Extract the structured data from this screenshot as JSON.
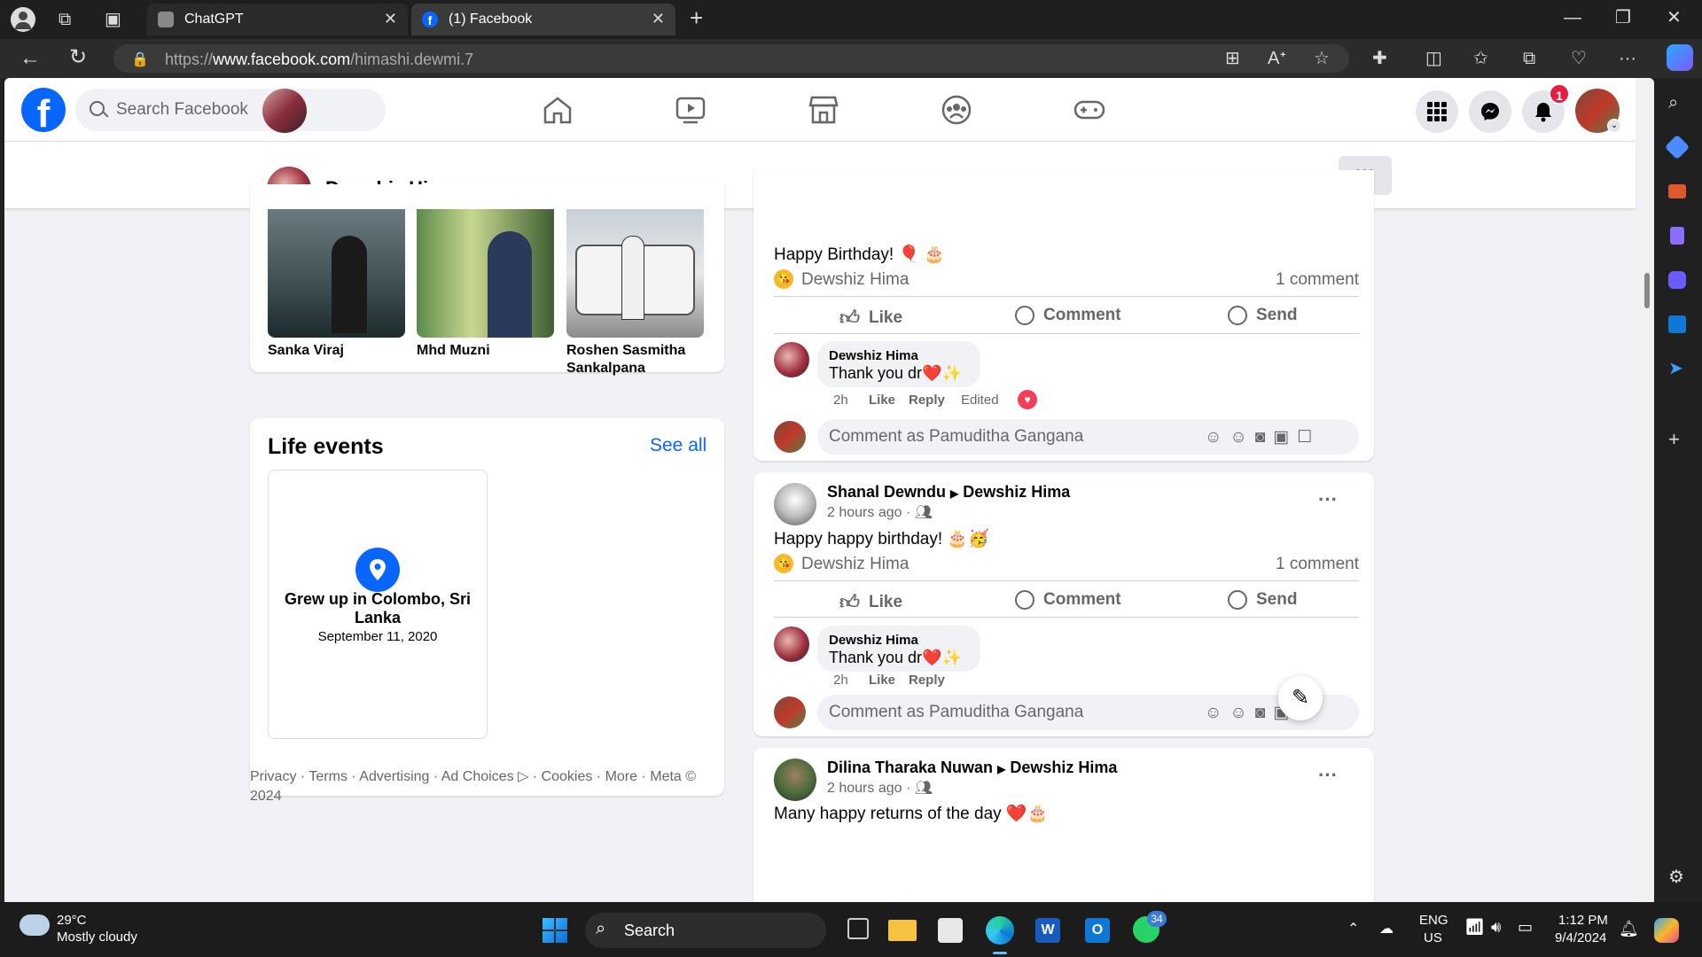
{
  "browser": {
    "tabs": [
      {
        "title": "ChatGPT",
        "active": false
      },
      {
        "title": "(1) Facebook",
        "active": true
      }
    ],
    "url_prefix": "https://",
    "url_domain": "www.facebook.com",
    "url_path": "/himashi.dewmi.7"
  },
  "fb": {
    "search_placeholder": "Search Facebook",
    "notification_count": "1",
    "profile_name": "Dewshiz Hima",
    "more_label": "···"
  },
  "friends": [
    {
      "name": "Sanka Viraj"
    },
    {
      "name": "Mhd Muzni"
    },
    {
      "name": "Roshen Sasmitha Sankalpana"
    }
  ],
  "life_events": {
    "title": "Life events",
    "see_all": "See all",
    "event_title": "Grew up in Colombo, Sri Lanka",
    "event_date": "September 11, 2020"
  },
  "footer": {
    "text": "Privacy · Terms · Advertising · Ad Choices ▷ · Cookies · More · Meta © 2024"
  },
  "post1": {
    "text": "Happy Birthday! 🎈 🎂",
    "reactor": "Dewshiz Hima",
    "comments": "1 comment",
    "reply_author": "Dewshiz Hima",
    "reply_text": "Thank you dr❤️✨",
    "reply_time": "2h",
    "reply_like": "Like",
    "reply_reply": "Reply",
    "reply_edited": "Edited",
    "comment_placeholder": "Comment as Pamuditha Gangana"
  },
  "post2": {
    "author": "Shanal Dewndu",
    "target": "Dewshiz Hima",
    "time": "2 hours ago ·",
    "text": "Happy happy birthday! 🎂🥳",
    "reactor": "Dewshiz Hima",
    "comments": "1 comment",
    "reply_author": "Dewshiz Hima",
    "reply_text": "Thank you dr❤️✨",
    "reply_time": "2h",
    "reply_like": "Like",
    "reply_reply": "Reply",
    "comment_placeholder": "Comment as Pamuditha Gangana"
  },
  "post3": {
    "author": "Dilina Tharaka Nuwan",
    "target": "Dewshiz Hima",
    "time": "2 hours ago ·",
    "text": "Many happy returns of the day ❤️🎂"
  },
  "actions": {
    "like": "Like",
    "comment": "Comment",
    "send": "Send"
  },
  "taskbar": {
    "temp": "29°C",
    "weather": "Mostly cloudy",
    "search": "Search",
    "whatsapp_badge": "34",
    "lang1": "ENG",
    "lang2": "US",
    "time": "1:12 PM",
    "date": "9/4/2024"
  },
  "colors": {
    "fb_blue": "#0866ff",
    "notif_red": "#e41e3f"
  }
}
